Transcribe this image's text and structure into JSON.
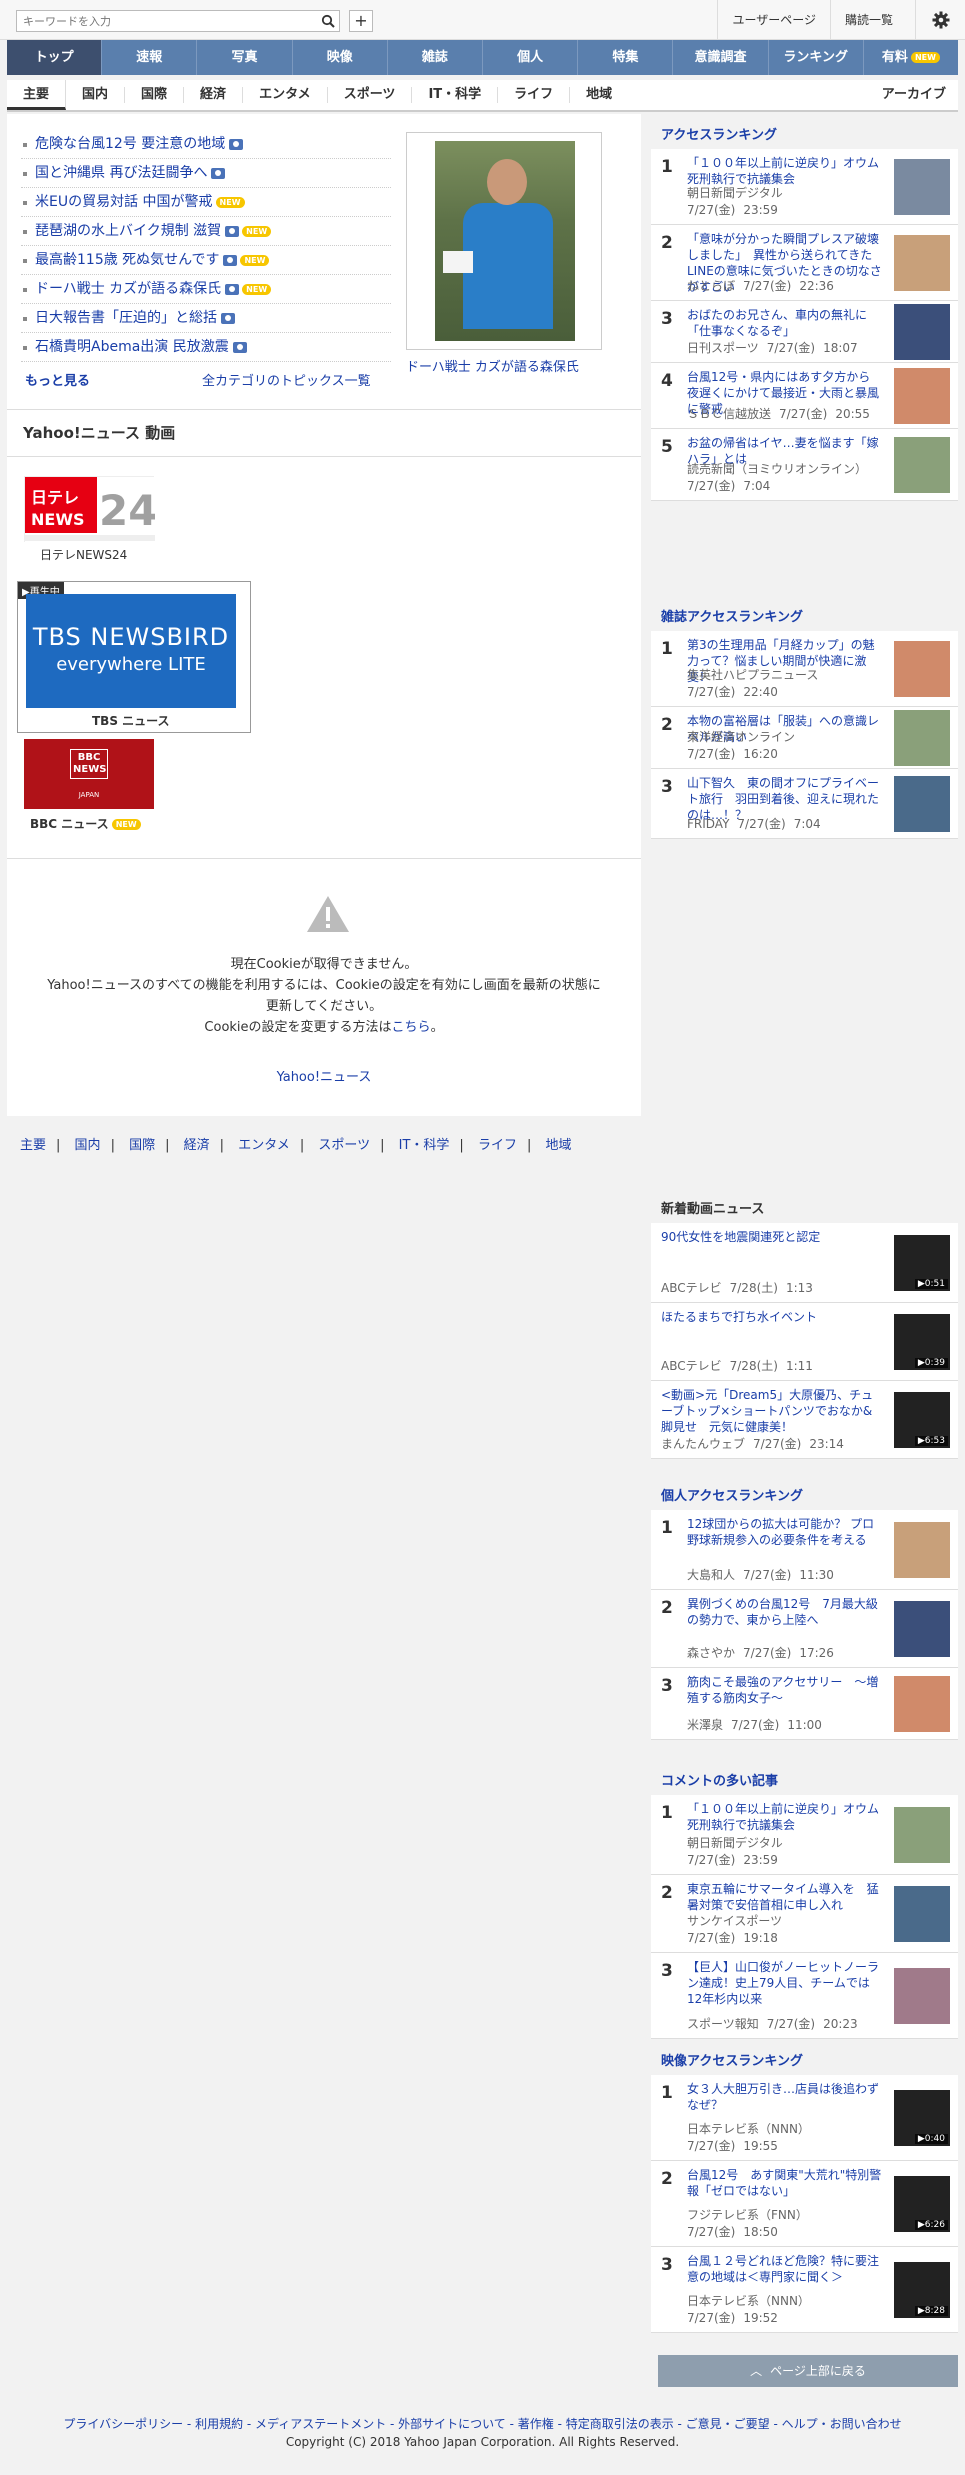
{
  "topbar": {
    "search_placeholder": "キーワードを入力",
    "plus_label": "+",
    "links": [
      "ユーザーページ",
      "購読一覧"
    ]
  },
  "gnav": {
    "items": [
      "トップ",
      "速報",
      "写真",
      "映像",
      "雑誌",
      "個人",
      "特集",
      "意識調査",
      "ランキング",
      "有料"
    ],
    "new_badge": "NEW"
  },
  "snav": {
    "items": [
      "主要",
      "国内",
      "国際",
      "経済",
      "エンタメ",
      "スポーツ",
      "IT・科学",
      "ライフ",
      "地域"
    ],
    "archive": "アーカイブ"
  },
  "topics": {
    "items": [
      {
        "text": "危険な台風12号 要注意の地域",
        "cam": true,
        "new": false
      },
      {
        "text": "国と沖縄県 再び法廷闘争へ",
        "cam": true,
        "new": false
      },
      {
        "text": "米EUの貿易対話 中国が警戒",
        "cam": false,
        "new": true
      },
      {
        "text": "琵琶湖の水上バイク規制 滋賀",
        "cam": true,
        "new": true
      },
      {
        "text": "最高齢115歳 死ぬ気せんです",
        "cam": true,
        "new": true
      },
      {
        "text": "ドーハ戦士 カズが語る森保氏",
        "cam": true,
        "new": true
      },
      {
        "text": "日大報告書「圧迫的」と総括",
        "cam": true,
        "new": false
      },
      {
        "text": "石橋貴明Abema出演 民放激震",
        "cam": true,
        "new": false
      }
    ],
    "more": "もっと見る",
    "all_topics": "全カテゴリのトピックス一覧",
    "photo_caption": "ドーハ戦士 カズが語る森保氏"
  },
  "video": {
    "title": "Yahoo!ニュース 動画",
    "channels": [
      {
        "name": "日テレNEWS24",
        "logo_text": "日テレNEWS24"
      },
      {
        "name": "TBS ニュース",
        "live_label": "▶再生中",
        "logo_line1": "TBS NEWSBIRD",
        "logo_line2": "everywhere LITE"
      },
      {
        "name": "BBC ニュース",
        "logo_text": "BBC NEWS",
        "logo_sub": "JAPAN"
      }
    ]
  },
  "cookie": {
    "line1": "現在Cookieが取得できません。",
    "line2": "Yahoo!ニュースのすべての機能を利用するには、Cookieの設定を有効にし画面を最新の状態に",
    "line3": "更新してください。",
    "line4_pre": "Cookieの設定を変更する方法は",
    "line4_link": "こちら",
    "line4_post": "。",
    "yahoo_link": "Yahoo!ニュース"
  },
  "bottom_nav": [
    "主要",
    "国内",
    "国際",
    "経済",
    "エンタメ",
    "スポーツ",
    "IT・科学",
    "ライフ",
    "地域"
  ],
  "access_ranking": {
    "title": "アクセスランキング",
    "items": [
      {
        "rank": "1",
        "title": "「１００年以上前に逆戻り」オウム死刑執行で抗議集会",
        "source": "朝日新聞デジタル",
        "date": "7/27(金)",
        "time": "23:59"
      },
      {
        "rank": "2",
        "title": "「意味が分かった瞬間プレスア破壊しました」　異性から送られてきたLINEの意味に気づいたときの切なさがすごい",
        "source": "ねとらぼ",
        "date": "7/27(金)",
        "time": "22:36"
      },
      {
        "rank": "3",
        "title": "おばたのお兄さん、車内の無礼に「仕事なくなるぞ」",
        "source": "日刊スポーツ",
        "date": "7/27(金)",
        "time": "18:07"
      },
      {
        "rank": "4",
        "title": "台風12号・県内にはあす夕方から夜遅くにかけて最接近・大雨と暴風に警戒",
        "source": "ＳＢＣ信越放送",
        "date": "7/27(金)",
        "time": "20:55"
      },
      {
        "rank": "5",
        "title": "お盆の帰省はイヤ…妻を悩ます「嫁ハラ」とは",
        "source": "読売新聞（ヨミウリオンライン）",
        "date": "7/27(金)",
        "time": "7:04"
      }
    ]
  },
  "magazine_ranking": {
    "title": "雑誌アクセスランキング",
    "items": [
      {
        "rank": "1",
        "title": "第3の生理用品「月経カップ」の魅力って？悩ましい期間が快適に激変！",
        "source": "集英社ハピプラニュース",
        "date": "7/27(金)",
        "time": "22:40"
      },
      {
        "rank": "2",
        "title": "本物の富裕層は「服装」への意識レベルが高い",
        "source": "東洋経済オンライン",
        "date": "7/27(金)",
        "time": "16:20"
      },
      {
        "rank": "3",
        "title": "山下智久　東の間オフにプライベート旅行　羽田到着後、迎えに現れたのは…！？",
        "source": "FRIDAY",
        "date": "7/27(金)",
        "time": "7:04"
      }
    ]
  },
  "new_videos": {
    "title": "新着動画ニュース",
    "items": [
      {
        "title": "90代女性を地震関連死と認定",
        "source": "ABCテレビ",
        "date": "7/28(土)",
        "time": "1:13",
        "duration": "▶0:51"
      },
      {
        "title": "ほたるまちで打ち水イベント",
        "source": "ABCテレビ",
        "date": "7/28(土)",
        "time": "1:11",
        "duration": "▶0:39"
      },
      {
        "title": "<動画>元「Dream5」大原優乃、チューブトップ×ショートパンツでおなか&脚見せ　元気に健康美！",
        "source": "まんたんウェブ",
        "date": "7/27(金)",
        "time": "23:14",
        "duration": "▶6:53"
      }
    ]
  },
  "personal_ranking": {
    "title": "個人アクセスランキング",
    "items": [
      {
        "rank": "1",
        "title": "12球団からの拡大は可能か？ プロ野球新規参入の必要条件を考える",
        "source": "大島和人",
        "date": "7/27(金)",
        "time": "11:30"
      },
      {
        "rank": "2",
        "title": "異例づくめの台風12号　7月最大級の勢力で、東から上陸へ",
        "source": "森さやか",
        "date": "7/27(金)",
        "time": "17:26"
      },
      {
        "rank": "3",
        "title": "筋肉こそ最強のアクセサリー　～増殖する筋肉女子～",
        "source": "米澤泉",
        "date": "7/27(金)",
        "time": "11:00"
      }
    ]
  },
  "comment_ranking": {
    "title": "コメントの多い記事",
    "items": [
      {
        "rank": "1",
        "title": "「１００年以上前に逆戻り」オウム死刑執行で抗議集会",
        "source": "朝日新聞デジタル",
        "date": "7/27(金)",
        "time": "23:59"
      },
      {
        "rank": "2",
        "title": "東京五輪にサマータイム導入を　猛暑対策で安倍首相に申し入れ",
        "source": "サンケイスポーツ",
        "date": "7/27(金)",
        "time": "19:18"
      },
      {
        "rank": "3",
        "title": "【巨人】山口俊がノーヒットノーラン達成！史上79人目、チームでは12年杉内以来",
        "source": "スポーツ報知",
        "date": "7/27(金)",
        "time": "20:23"
      }
    ]
  },
  "video_ranking": {
    "title": "映像アクセスランキング",
    "items": [
      {
        "rank": "1",
        "title": "女３人大胆万引き…店員は後追わず　なぜ？",
        "source": "日本テレビ系（NNN）",
        "date": "7/27(金)",
        "time": "19:55",
        "duration": "▶0:40"
      },
      {
        "rank": "2",
        "title": "台風12号　あす関東\"大荒れ\"特別警報「ゼロではない」",
        "source": "フジテレビ系（FNN）",
        "date": "7/27(金)",
        "time": "18:50",
        "duration": "▶6:26"
      },
      {
        "rank": "3",
        "title": "台風１２号どれほど危険？特に要注意の地域は＜専門家に聞く＞",
        "source": "日本テレビ系（NNN）",
        "date": "7/27(金)",
        "time": "19:52",
        "duration": "▶8:28"
      }
    ]
  },
  "page_top": "ページ上部に戻る",
  "footer": {
    "links": "プライバシーポリシー - 利用規約 - メディアステートメント - 外部サイトについて - 著作権 - 特定商取引法の表示 - ご意見・ご要望 - ヘルプ・お問い合わせ",
    "copyright": "Copyright (C) 2018 Yahoo Japan Corporation. All Rights Reserved."
  }
}
